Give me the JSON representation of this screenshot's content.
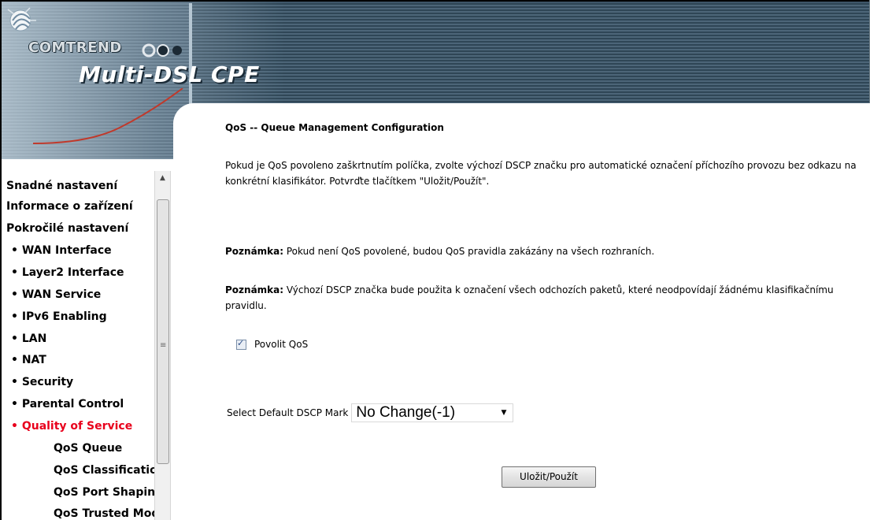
{
  "header": {
    "brand": "COMTREND",
    "product": "Multi-DSL CPE"
  },
  "sidebar": {
    "items": [
      {
        "label": "Snadné nastavení",
        "level": 0
      },
      {
        "label": "Informace o zařízení",
        "level": 0
      },
      {
        "label": "Pokročilé nastavení",
        "level": 0
      },
      {
        "label": "• WAN Interface",
        "level": 1
      },
      {
        "label": "• Layer2 Interface",
        "level": 1
      },
      {
        "label": "• WAN Service",
        "level": 1
      },
      {
        "label": "• IPv6 Enabling",
        "level": 1
      },
      {
        "label": "• LAN",
        "level": 1
      },
      {
        "label": "• NAT",
        "level": 1
      },
      {
        "label": "• Security",
        "level": 1
      },
      {
        "label": "• Parental Control",
        "level": 1
      },
      {
        "label": "• Quality of Service",
        "level": 1,
        "active": true
      },
      {
        "label": "QoS Queue",
        "level": 2
      },
      {
        "label": "QoS Classification",
        "level": 2
      },
      {
        "label": "QoS Port Shaping",
        "level": 2
      },
      {
        "label": "QoS Trusted Mode",
        "level": 2
      }
    ],
    "active_color": "#e8001c"
  },
  "main": {
    "title": "QoS -- Queue Management Configuration",
    "description": "Pokud je QoS povoleno zaškrtnutím políčka, zvolte výchozí DSCP značku pro automatické označení příchozího provozu bez odkazu na konkrétní klasifikátor. Potvrďte tlačítkem \"Uložit/Použít\".",
    "note1_label": "Poznámka:",
    "note1_text": " Pokud není QoS povolené, budou QoS pravidla zakázány na všech rozhraních.",
    "note2_label": "Poznámka:",
    "note2_text": " Výchozí DSCP značka bude použita k označení všech odchozích paketů, které neodpovídají žádnému klasifikačnímu pravidlu.",
    "enable_qos_label": "Povolit QoS",
    "enable_qos_checked": true,
    "dscp_label": "Select Default DSCP Mark",
    "dscp_value": "No Change(-1)",
    "save_label": "Uložit/Použít"
  },
  "colors": {
    "banner": "#3d5568",
    "accent_red": "#e8001c"
  },
  "icons": [
    "comtrend-logo-icon",
    "checkbox-check-icon",
    "dropdown-arrow-icon",
    "scroll-up-arrow-icon"
  ]
}
